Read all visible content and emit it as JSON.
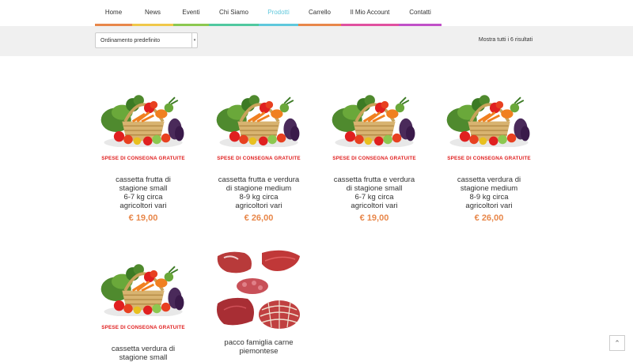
{
  "nav": {
    "items": [
      {
        "label": "Home",
        "color": "#e8874a"
      },
      {
        "label": "News",
        "color": "#f0c84a"
      },
      {
        "label": "Eventi",
        "color": "#8cc850"
      },
      {
        "label": "Chi Siamo",
        "color": "#50c8a0"
      },
      {
        "label": "Prodotti",
        "color": "#5fc8dc",
        "active": true
      },
      {
        "label": "Carrello",
        "color": "#e8874a"
      },
      {
        "label": "Il Mio Account",
        "color": "#e050a0"
      },
      {
        "label": "Contatti",
        "color": "#c050c8"
      }
    ]
  },
  "toolbar": {
    "sort_value": "Ordinamento predefinito",
    "result_count": "Mostra tutti i 6 risultati"
  },
  "products": [
    {
      "name_lines": [
        "cassetta frutta di",
        "stagione small",
        "6-7 kg circa",
        "agricoltori vari"
      ],
      "price": "€ 19,00",
      "image": "basket-image",
      "banner": "SPESE DI CONSEGNA GRATUITE"
    },
    {
      "name_lines": [
        "cassetta frutta e verdura",
        "di stagione medium",
        "8-9 kg circa",
        "agricoltori vari"
      ],
      "price": "€ 26,00",
      "image": "basket-image",
      "banner": "SPESE DI CONSEGNA GRATUITE"
    },
    {
      "name_lines": [
        "cassetta frutta e verdura",
        "di stagione small",
        "6-7 kg circa",
        "agricoltori vari"
      ],
      "price": "€ 19,00",
      "image": "basket-image",
      "banner": "SPESE DI CONSEGNA GRATUITE"
    },
    {
      "name_lines": [
        "cassetta verdura di",
        "stagione medium",
        "8-9 kg circa",
        "agricoltori vari"
      ],
      "price": "€ 26,00",
      "image": "basket-image",
      "banner": "SPESE DI CONSEGNA GRATUITE"
    },
    {
      "name_lines": [
        "cassetta verdura di",
        "stagione small"
      ],
      "price": "",
      "image": "basket-image",
      "banner": "SPESE DI CONSEGNA GRATUITE"
    },
    {
      "name_lines": [
        "pacco famiglia carne",
        "piemontese"
      ],
      "price": "",
      "image": "meat-image"
    }
  ],
  "scroll_top_icon": "chevron-up-icon"
}
